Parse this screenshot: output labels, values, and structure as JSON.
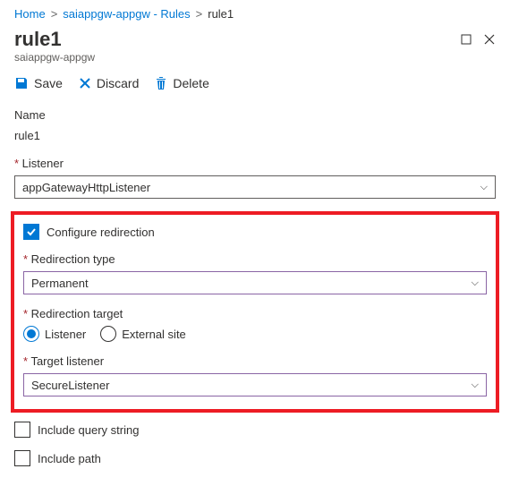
{
  "breadcrumb": {
    "home": "Home",
    "resource": "saiappgw-appgw - Rules",
    "current": "rule1"
  },
  "header": {
    "title": "rule1",
    "subtitle": "saiappgw-appgw"
  },
  "toolbar": {
    "save": "Save",
    "discard": "Discard",
    "delete": "Delete"
  },
  "fields": {
    "name_label": "Name",
    "name_value": "rule1",
    "listener_label": "Listener",
    "listener_value": "appGatewayHttpListener",
    "configure_redirection": "Configure redirection",
    "redirection_type_label": "Redirection type",
    "redirection_type_value": "Permanent",
    "redirection_target_label": "Redirection target",
    "target_opt_listener": "Listener",
    "target_opt_external": "External site",
    "target_listener_label": "Target listener",
    "target_listener_value": "SecureListener",
    "include_query": "Include query string",
    "include_path": "Include path"
  }
}
